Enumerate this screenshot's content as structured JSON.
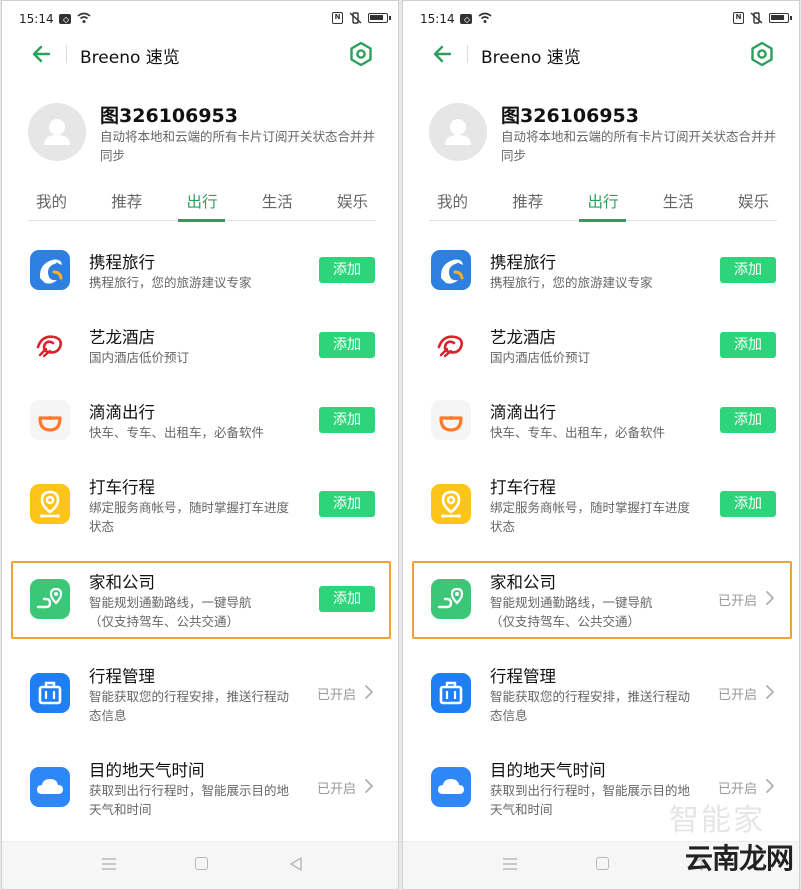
{
  "status_bar": {
    "time": "15:14"
  },
  "header": {
    "title": "Breeno 速览"
  },
  "profile": {
    "name": "图326106953",
    "description": "自动将本地和云端的所有卡片订阅开关状态合并并同步"
  },
  "tabs": [
    {
      "label": "我的",
      "active": false
    },
    {
      "label": "推荐",
      "active": false
    },
    {
      "label": "出行",
      "active": true
    },
    {
      "label": "生活",
      "active": false
    },
    {
      "label": "娱乐",
      "active": false
    }
  ],
  "cards": [
    {
      "title": "携程旅行",
      "desc": "携程旅行，您的旅游建议专家",
      "icon": "ctrip-dolphin-icon",
      "color": "#2d7fe0"
    },
    {
      "title": "艺龙酒店",
      "desc": "国内酒店低价预订",
      "icon": "elong-logo-icon",
      "color": "#d8232a"
    },
    {
      "title": "滴滴出行",
      "desc": "快车、专车、出租车，必备软件",
      "icon": "didi-logo-icon",
      "color": "#ff7a2f"
    },
    {
      "title": "打车行程",
      "desc": "绑定服务商帐号，随时掌握打车进度状态",
      "icon": "taxi-location-icon",
      "color": "#ffc41a"
    },
    {
      "title": "家和公司",
      "desc": "智能规划通勤路线，一键导航\n（仅支持驾车、公共交通）",
      "icon": "commute-route-icon",
      "color": "#3cc778"
    },
    {
      "title": "行程管理",
      "desc": "智能获取您的行程安排，推送行程动态信息",
      "icon": "luggage-icon",
      "color": "#1f7ff2"
    },
    {
      "title": "目的地天气时间",
      "desc": "获取到出行行程时，智能展示目的地天气和时间",
      "icon": "cloud-icon",
      "color": "#2f86f6"
    }
  ],
  "labels": {
    "add": "添加",
    "enabled": "已开启"
  },
  "screens": {
    "left": {
      "card_states": [
        "add",
        "add",
        "add",
        "add",
        "add",
        "enabled",
        "enabled"
      ]
    },
    "right": {
      "card_states": [
        "add",
        "add",
        "add",
        "add",
        "enabled",
        "enabled",
        "enabled"
      ]
    }
  },
  "highlight_color": "#f0a23a",
  "accent_color": "#2ba05c",
  "button_color": "#2ed47a",
  "watermark": {
    "top": "智能家",
    "bottom": "云南龙网"
  }
}
